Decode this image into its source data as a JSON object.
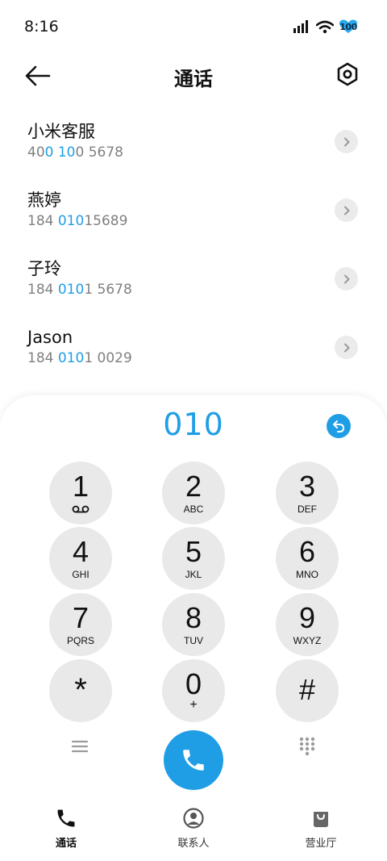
{
  "status": {
    "time": "8:16",
    "battery": "100"
  },
  "header": {
    "title": "通话"
  },
  "results": [
    {
      "name": "小米客服",
      "number_parts": [
        "40",
        "0 10",
        "0 5678"
      ]
    },
    {
      "name": "燕婷",
      "number_parts": [
        "184 ",
        "010",
        "15689"
      ]
    },
    {
      "name": "子玲",
      "number_parts": [
        "184 ",
        "010",
        "1 5678"
      ]
    },
    {
      "name": "Jason",
      "number_parts": [
        "184 ",
        "010",
        "1 0029"
      ]
    }
  ],
  "dialer": {
    "input": "010",
    "keys": [
      {
        "digit": "1",
        "letters": ""
      },
      {
        "digit": "2",
        "letters": "ABC"
      },
      {
        "digit": "3",
        "letters": "DEF"
      },
      {
        "digit": "4",
        "letters": "GHI"
      },
      {
        "digit": "5",
        "letters": "JKL"
      },
      {
        "digit": "6",
        "letters": "MNO"
      },
      {
        "digit": "7",
        "letters": "PQRS"
      },
      {
        "digit": "8",
        "letters": "TUV"
      },
      {
        "digit": "9",
        "letters": "WXYZ"
      },
      {
        "digit": "*",
        "letters": ""
      },
      {
        "digit": "0",
        "letters": "+"
      },
      {
        "digit": "#",
        "letters": ""
      }
    ]
  },
  "nav": {
    "calls": "通话",
    "contacts": "联系人",
    "service_hall": "营业厅"
  },
  "colors": {
    "accent": "#1f9ee6",
    "key_bg": "#e9e9e9"
  },
  "icons": {
    "back": "arrow-left-icon",
    "settings": "hexagon-settings-icon",
    "chevron": "chevron-right-icon",
    "delete": "undo-delete-icon",
    "voicemail": "voicemail-icon",
    "call": "phone-icon",
    "menu": "menu-lines-icon",
    "keypad": "keypad-dots-icon"
  }
}
